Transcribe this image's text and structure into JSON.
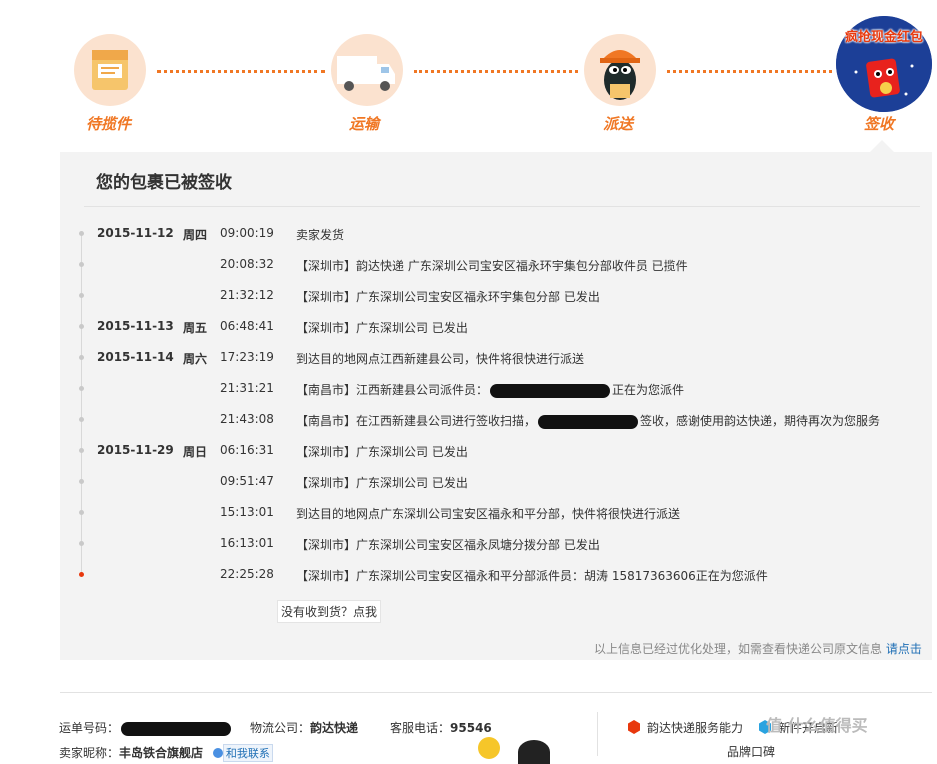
{
  "steps": [
    {
      "label": "待揽件",
      "icon": "package-icon"
    },
    {
      "label": "运输",
      "icon": "truck-icon"
    },
    {
      "label": "派送",
      "icon": "courier-penguin-icon"
    },
    {
      "label": "签收",
      "icon": "red-envelope-icon"
    }
  ],
  "promo": {
    "text": "疯抢现金红包"
  },
  "panel": {
    "title": "您的包裹已被签收",
    "not_received": "没有收到货？点我",
    "footer_note": "以上信息已经过优化处理，如需查看快递公司原文信息",
    "footer_link": "请点击"
  },
  "tracking": [
    {
      "date": "2015-11-12",
      "day": "周四",
      "time": "09:00:19",
      "desc": "卖家发货"
    },
    {
      "date": "",
      "day": "",
      "time": "20:08:32",
      "desc": "【深圳市】韵达快递 广东深圳公司宝安区福永环宇集包分部收件员 已揽件"
    },
    {
      "date": "",
      "day": "",
      "time": "21:32:12",
      "desc": "【深圳市】广东深圳公司宝安区福永环宇集包分部 已发出"
    },
    {
      "date": "2015-11-13",
      "day": "周五",
      "time": "06:48:41",
      "desc": "【深圳市】广东深圳公司 已发出"
    },
    {
      "date": "2015-11-14",
      "day": "周六",
      "time": "17:23:19",
      "desc": "到达目的地网点江西新建县公司，快件将很快进行派送"
    },
    {
      "date": "",
      "day": "",
      "time": "21:31:21",
      "desc_pre": "【南昌市】江西新建县公司派件员：",
      "desc_post": "正在为您派件"
    },
    {
      "date": "",
      "day": "",
      "time": "21:43:08",
      "desc_pre": "【南昌市】在江西新建县公司进行签收扫描，",
      "desc_post": "签收，感谢使用韵达快递，期待再次为您服务"
    },
    {
      "date": "2015-11-29",
      "day": "周日",
      "time": "06:16:31",
      "desc": "【深圳市】广东深圳公司 已发出"
    },
    {
      "date": "",
      "day": "",
      "time": "09:51:47",
      "desc": "【深圳市】广东深圳公司 已发出"
    },
    {
      "date": "",
      "day": "",
      "time": "15:13:01",
      "desc": "到达目的地网点广东深圳公司宝安区福永和平分部，快件将很快进行派送"
    },
    {
      "date": "",
      "day": "",
      "time": "16:13:01",
      "desc": "【深圳市】广东深圳公司宝安区福永凤塘分拨分部 已发出"
    },
    {
      "date": "",
      "day": "",
      "time": "22:25:28",
      "desc": "【深圳市】广东深圳公司宝安区福永和平分部派件员：胡涛 15817363606正在为您派件"
    }
  ],
  "info": {
    "waybill_label": "运单号码：",
    "carrier_label": "物流公司：",
    "carrier": "韵达快递",
    "phone_label": "客服电话：",
    "phone": "95546",
    "seller_label": "卖家昵称：",
    "seller": "丰岛铁合旗舰店",
    "contact": "和我联系",
    "service_rating": "韵达快递服务能力",
    "new_service": "新件开启新",
    "brand": "品牌口碑"
  },
  "watermark": "值 什么值得买",
  "colors": {
    "accent": "#f07724",
    "red": "#e8380d",
    "panel_bg": "#f3f3f3",
    "link": "#1f6fb5"
  }
}
